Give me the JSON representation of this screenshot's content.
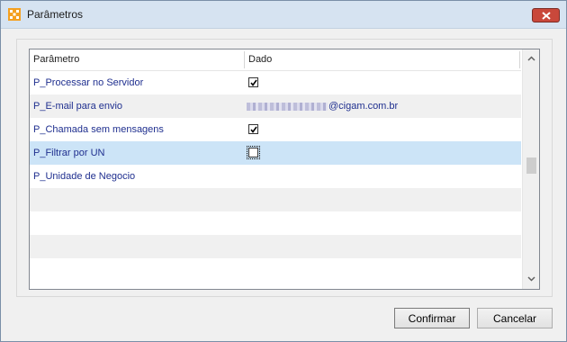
{
  "window": {
    "title": "Parâmetros"
  },
  "grid": {
    "columns": [
      "Parâmetro",
      "Dado"
    ],
    "rows": [
      {
        "name": "P_Processar no Servidor",
        "type": "checkbox",
        "checked": true
      },
      {
        "name": "P_E-mail para envio",
        "type": "text",
        "value": "@cigam.com.br"
      },
      {
        "name": "P_Chamada sem mensagens",
        "type": "checkbox",
        "checked": true
      },
      {
        "name": "P_Filtrar por UN",
        "type": "checkbox",
        "checked": false,
        "selected": true
      },
      {
        "name": "P_Unidade de Negocio",
        "type": "text",
        "value": ""
      }
    ]
  },
  "buttons": {
    "confirm": "Confirmar",
    "cancel": "Cancelar"
  }
}
